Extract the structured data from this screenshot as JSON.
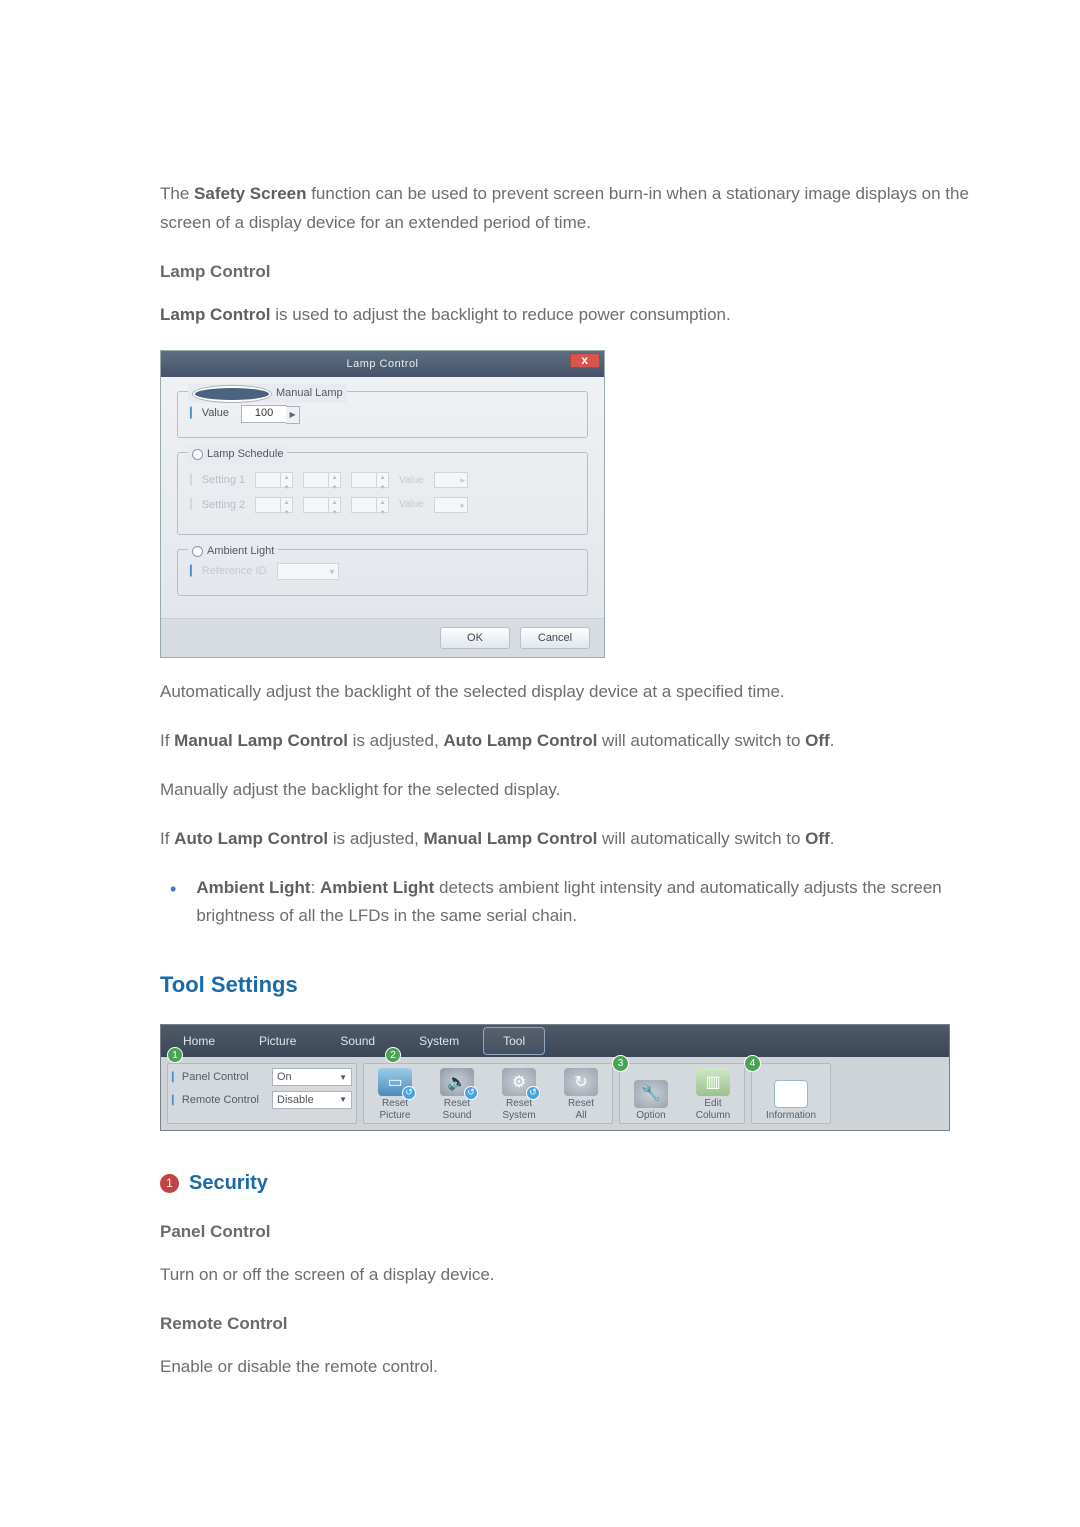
{
  "intro_para": {
    "pre": "The ",
    "b": "Safety Screen",
    "post": " function can be used to prevent screen burn-in when a stationary image displays on the screen of a display device for an extended period of time."
  },
  "lamp": {
    "heading": "Lamp Control",
    "desc_b": "Lamp Control",
    "desc_post": " is used to adjust the backlight to reduce power consumption."
  },
  "dialog": {
    "title": "Lamp Control",
    "close": "x",
    "manual_legend": "Manual Lamp",
    "value_label": "Value",
    "value": "100",
    "schedule_legend": "Lamp Schedule",
    "setting1": "Setting 1",
    "setting2": "Setting 2",
    "val_lbl": "Value",
    "ambient_legend": "Ambient Light",
    "reference": "Reference ID",
    "ok": "OK",
    "cancel": "Cancel"
  },
  "after_dialog": {
    "p1": "Automatically adjust the backlight of the selected display device at a specified time.",
    "p2_a": "If ",
    "p2_b1": "Manual Lamp Control",
    "p2_c": " is adjusted, ",
    "p2_b2": "Auto Lamp Control",
    "p2_d": " will automatically switch to ",
    "p2_b3": "Off",
    "p2_e": ".",
    "p3": "Manually adjust the backlight for the selected display.",
    "p4_a": "If ",
    "p4_b1": "Auto Lamp Control",
    "p4_c": " is adjusted, ",
    "p4_b2": "Manual Lamp Control",
    "p4_d": " will automatically switch to ",
    "p4_b3": "Off",
    "p4_e": ".",
    "bullet_b1": "Ambient Light",
    "bullet_sep": ": ",
    "bullet_b2": "Ambient Light",
    "bullet_rest": " detects ambient light intensity and automatically adjusts the screen brightness of all the LFDs in the same serial chain."
  },
  "tool_heading": "Tool Settings",
  "ribbon": {
    "tabs": {
      "home": "Home",
      "picture": "Picture",
      "sound": "Sound",
      "system": "System",
      "tool": "Tool"
    },
    "nums": {
      "n1": "1",
      "n2": "2",
      "n3": "3",
      "n4": "4"
    },
    "panel_control": "Panel Control",
    "panel_value": "On",
    "remote_control": "Remote Control",
    "remote_value": "Disable",
    "reset_picture_l1": "Reset",
    "reset_picture_l2": "Picture",
    "reset_sound_l1": "Reset",
    "reset_sound_l2": "Sound",
    "reset_system_l1": "Reset",
    "reset_system_l2": "System",
    "reset_all_l1": "Reset",
    "reset_all_l2": "All",
    "option": "Option",
    "edit_l1": "Edit",
    "edit_l2": "Column",
    "information": "Information"
  },
  "security": {
    "num": "1",
    "title": "Security",
    "panel_h": "Panel Control",
    "panel_p": "Turn on or off the screen of a display device.",
    "remote_h": "Remote Control",
    "remote_p": "Enable or disable the remote control."
  }
}
